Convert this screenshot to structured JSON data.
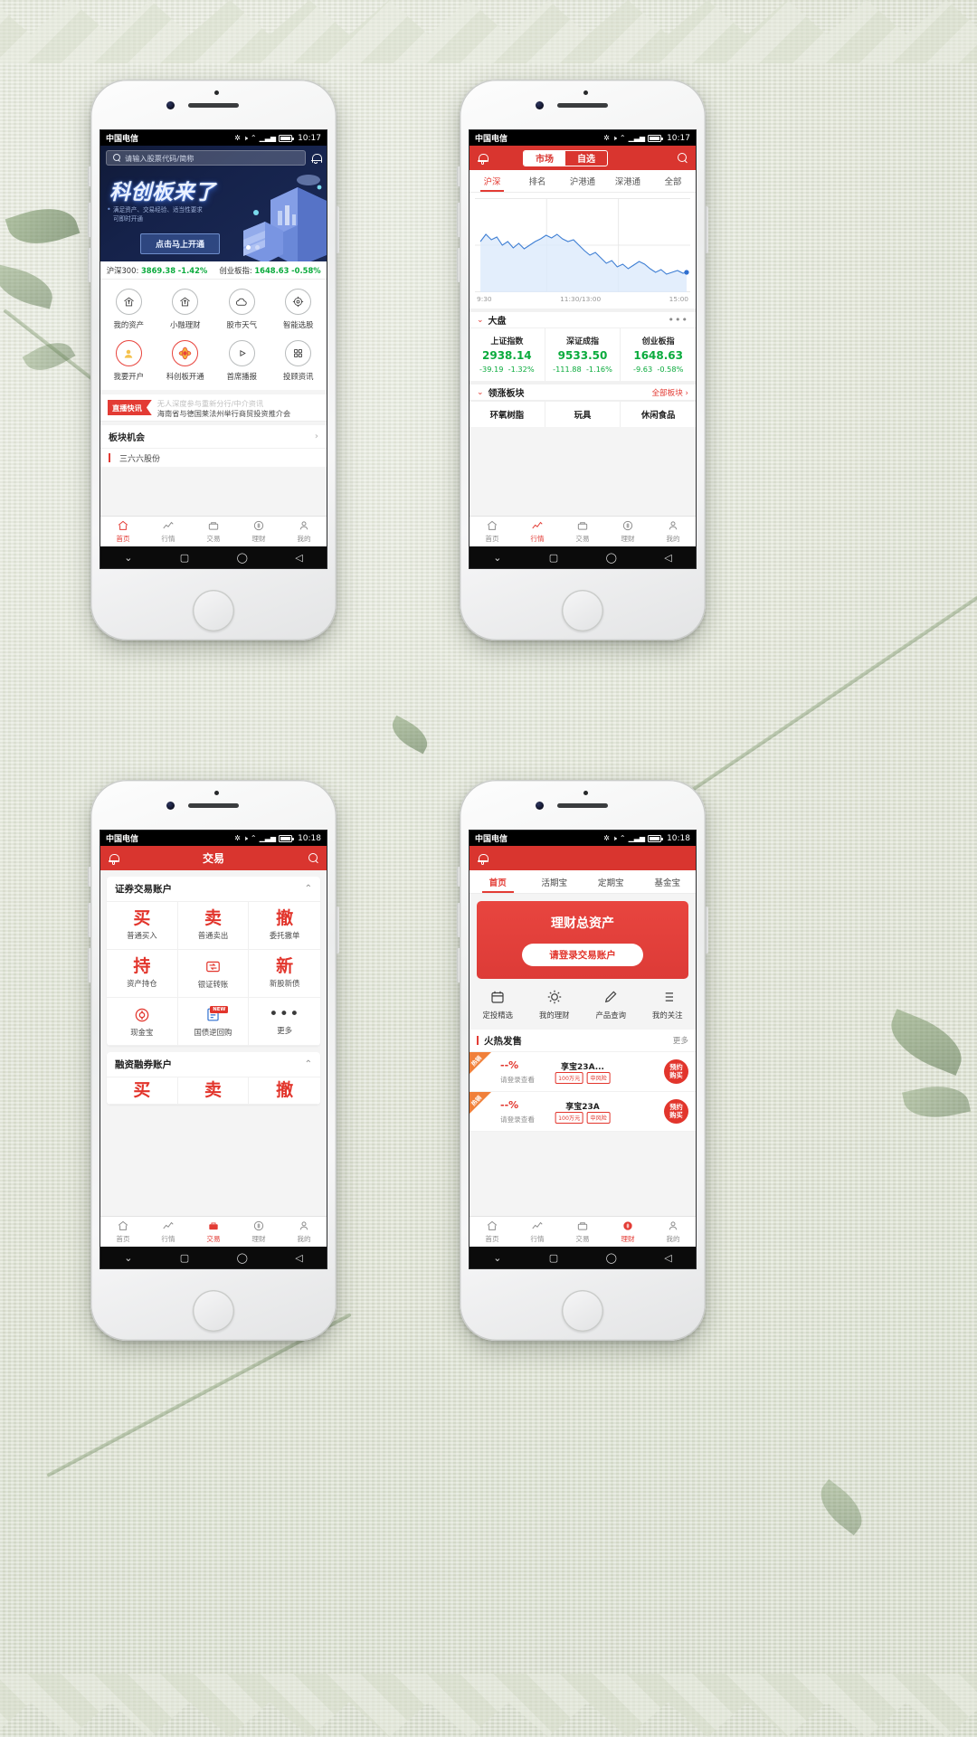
{
  "status": {
    "carrier": "中国电信",
    "time_top": "10:17",
    "time_bottom": "10:18"
  },
  "phone1": {
    "search_placeholder": "请输入股票代码/简称",
    "hero": {
      "title": "科创板来了",
      "subtitle": "满足资产、交易经验、适当性要求\n可即时开通",
      "cta": "点击马上开通"
    },
    "ticker": [
      {
        "name": "沪深300",
        "value": "3869.38",
        "change": "-1.42%"
      },
      {
        "name": "创业板指",
        "value": "1648.63",
        "change": "-0.58%"
      }
    ],
    "grid": [
      {
        "label": "我的资产",
        "icon": "house-arrow-icon",
        "highlight": false
      },
      {
        "label": "小融理财",
        "icon": "house-arrow-icon",
        "highlight": false
      },
      {
        "label": "股市天气",
        "icon": "cloud-icon",
        "highlight": false
      },
      {
        "label": "智能选股",
        "icon": "target-icon",
        "highlight": false
      },
      {
        "label": "我要开户",
        "icon": "user-icon",
        "highlight": true
      },
      {
        "label": "科创板开通",
        "icon": "compass-icon",
        "highlight": true
      },
      {
        "label": "首席播报",
        "icon": "play-icon",
        "highlight": false
      },
      {
        "label": "投顾资讯",
        "icon": "grid-icon",
        "highlight": false
      }
    ],
    "news": {
      "flag": "直播快讯",
      "line1": "无人深度参与重新分行/中介资讯",
      "line2": "海南省与德国莱法州举行商贸投资推介会"
    },
    "section_row": "板块机会",
    "section_row2": "三六六股份"
  },
  "phone2": {
    "segments": [
      {
        "label": "市场",
        "active": true
      },
      {
        "label": "自选",
        "active": false
      }
    ],
    "tabs": [
      {
        "label": "沪深",
        "active": true
      },
      {
        "label": "排名",
        "active": false
      },
      {
        "label": "沪港通",
        "active": false
      },
      {
        "label": "深港通",
        "active": false
      },
      {
        "label": "全部",
        "active": false
      }
    ],
    "chart_axis": [
      "9:30",
      "11:30/13:00",
      "15:00"
    ],
    "market_section": "大盘",
    "indices": [
      {
        "name": "上证指数",
        "value": "2938.14",
        "change": "-39.19",
        "pct": "-1.32%"
      },
      {
        "name": "深证成指",
        "value": "9533.50",
        "change": "-111.88",
        "pct": "-1.16%"
      },
      {
        "name": "创业板指",
        "value": "1648.63",
        "change": "-9.63",
        "pct": "-0.58%"
      }
    ],
    "sector_section": "领涨板块",
    "sector_more": "全部板块",
    "sectors": [
      "环氧树脂",
      "玩具",
      "休闲食品"
    ]
  },
  "phone3": {
    "title": "交易",
    "cards": [
      {
        "title": "证券交易账户",
        "items": [
          {
            "big": "买",
            "sub": "普通买入",
            "type": "text"
          },
          {
            "big": "卖",
            "sub": "普通卖出",
            "type": "text"
          },
          {
            "big": "撤",
            "sub": "委托撤单",
            "type": "text"
          },
          {
            "big": "持",
            "sub": "资产持仓",
            "type": "text"
          },
          {
            "big": "",
            "sub": "银证转账",
            "type": "transfer-icon"
          },
          {
            "big": "新",
            "sub": "新股新债",
            "type": "text"
          },
          {
            "big": "",
            "sub": "现金宝",
            "type": "cash-icon"
          },
          {
            "big": "",
            "sub": "国债逆回购",
            "type": "doc-icon",
            "tag": "NEW"
          },
          {
            "big": "",
            "sub": "更多",
            "type": "dots"
          }
        ]
      },
      {
        "title": "融资融券账户",
        "items": [
          {
            "big": "买",
            "sub": "",
            "type": "text"
          },
          {
            "big": "卖",
            "sub": "",
            "type": "text"
          },
          {
            "big": "撤",
            "sub": "",
            "type": "text"
          }
        ]
      }
    ]
  },
  "phone4": {
    "tabs": [
      {
        "label": "首页",
        "active": true
      },
      {
        "label": "活期宝",
        "active": false
      },
      {
        "label": "定期宝",
        "active": false
      },
      {
        "label": "基金宝",
        "active": false
      }
    ],
    "hero": {
      "title": "理财总资产",
      "button": "请登录交易账户"
    },
    "quick": [
      {
        "label": "定投精选",
        "icon": "calendar-icon"
      },
      {
        "label": "我的理财",
        "icon": "sun-icon"
      },
      {
        "label": "产品查询",
        "icon": "pen-icon"
      },
      {
        "label": "我的关注",
        "icon": "list-icon"
      }
    ],
    "hot_title": "火热发售",
    "hot_more": "更多",
    "products": [
      {
        "corner": "热销",
        "rate": "--%",
        "sub": "请登录查看",
        "name": "享宝23A...",
        "badges": [
          "100万元",
          "中风险"
        ],
        "btn_line1": "预约",
        "btn_line2": "购买"
      },
      {
        "corner": "热销",
        "rate": "--%",
        "sub": "请登录查看",
        "name": "享宝23A",
        "badges": [
          "100万元",
          "中风险"
        ],
        "btn_line1": "预约",
        "btn_line2": "购买"
      }
    ]
  },
  "tabbar": [
    {
      "label": "首页",
      "icon": "home-icon"
    },
    {
      "label": "行情",
      "icon": "chart-icon"
    },
    {
      "label": "交易",
      "icon": "trade-icon"
    },
    {
      "label": "理财",
      "icon": "wallet-icon"
    },
    {
      "label": "我的",
      "icon": "person-icon"
    }
  ],
  "tabbar_active": {
    "phone1": 0,
    "phone2": 1,
    "phone3": 2,
    "phone4": 3
  },
  "colors": {
    "brand_red": "#d9352f",
    "down_green": "#0bab3d",
    "hero_navy": "#15224a"
  }
}
